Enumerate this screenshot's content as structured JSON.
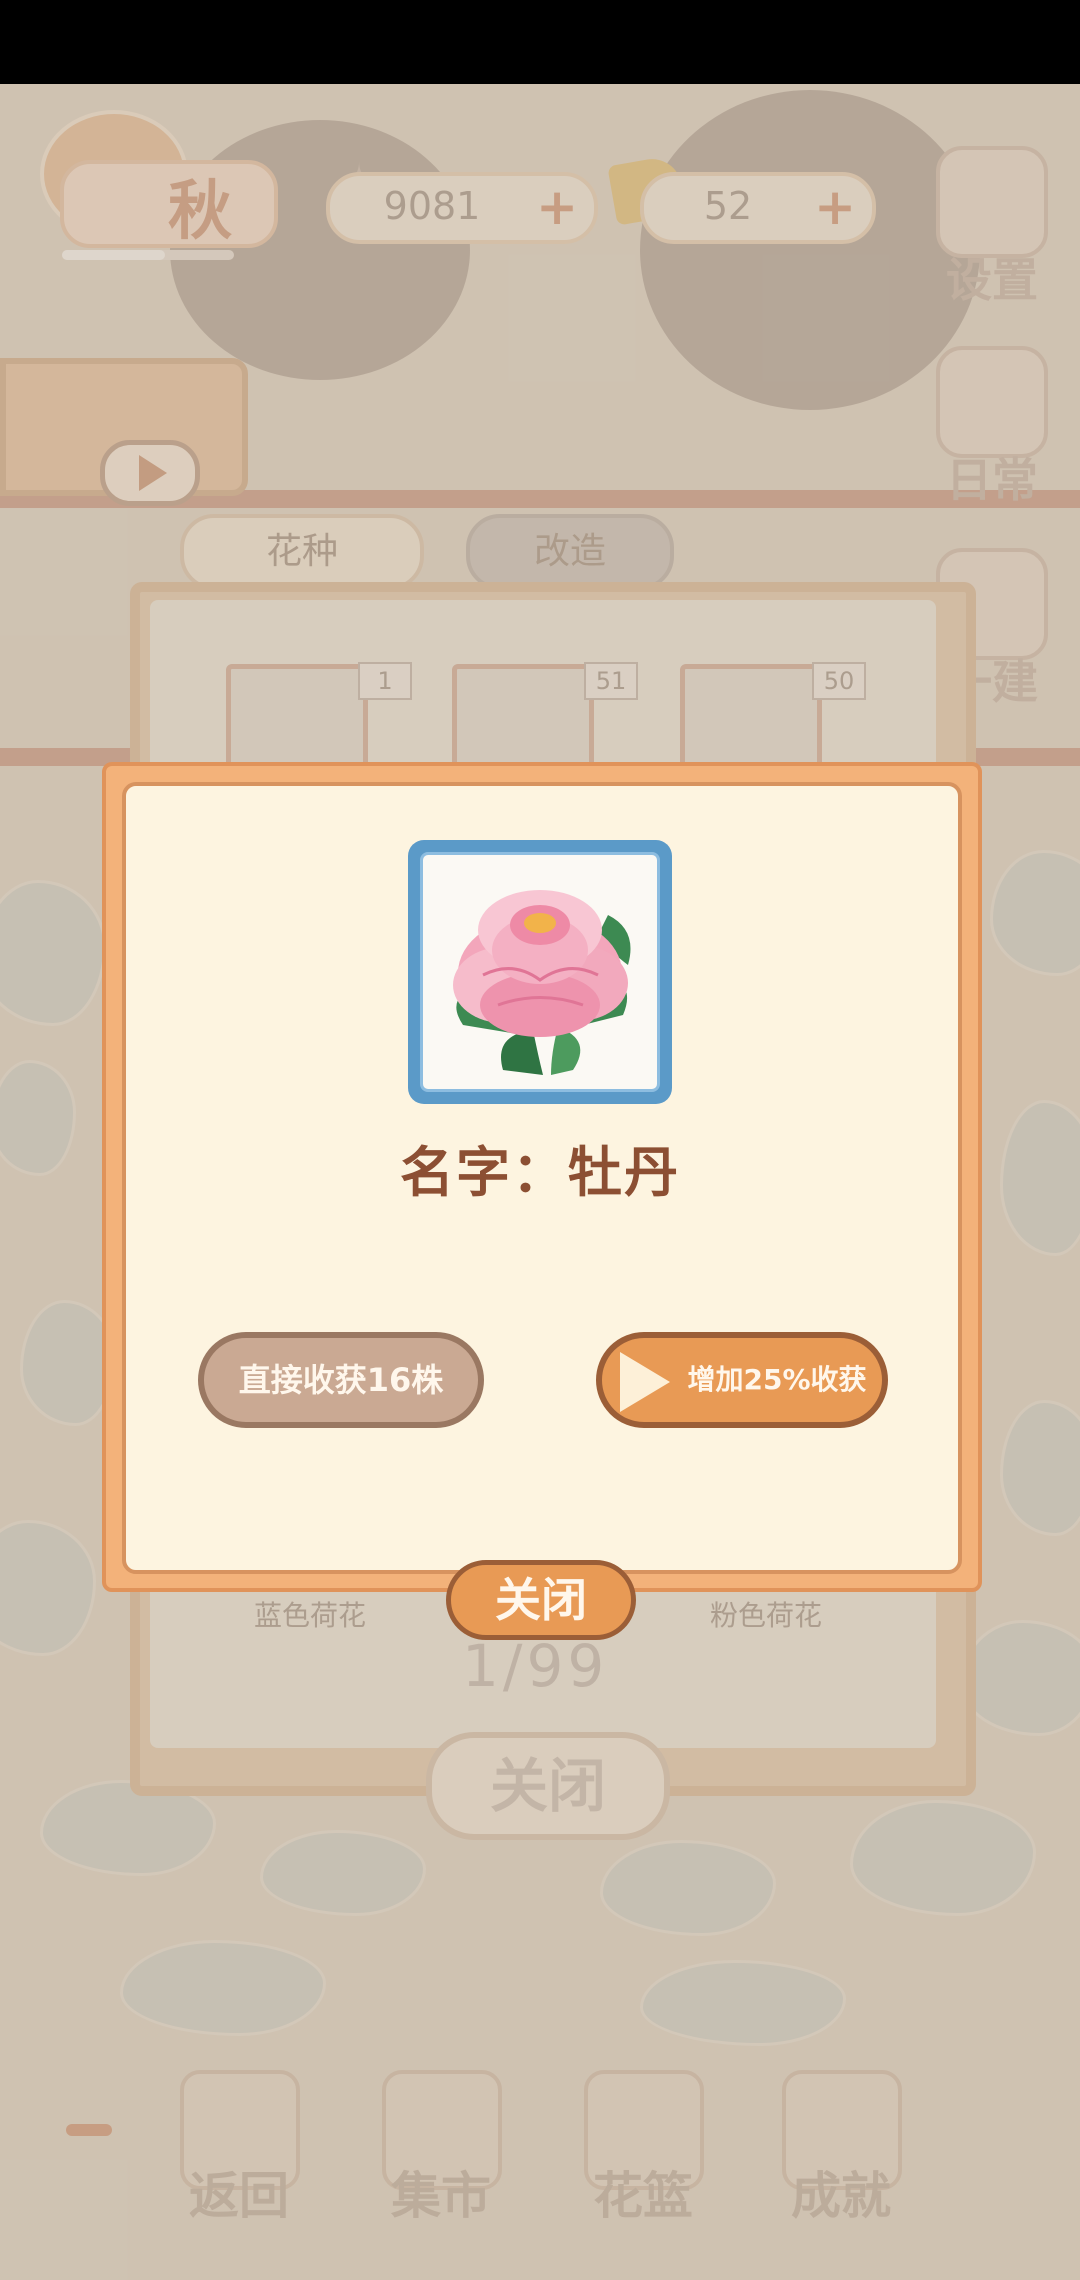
{
  "hud": {
    "season_label": "秋",
    "fish_bones": "9081",
    "cheese": "52",
    "plus_symbol": "+"
  },
  "side_menu": {
    "settings_label": "设置",
    "daily_label": "日常",
    "build_label": "一建"
  },
  "tabs": {
    "seed_label": "花种",
    "modify_label": "改造"
  },
  "seed_counts": [
    "1",
    "51",
    "50"
  ],
  "background_panel": {
    "left_item_label": "蓝色荷花",
    "right_item_label": "粉色荷花",
    "count": "1/99",
    "close_label": "关闭"
  },
  "bottom_nav": {
    "back_label": "返回",
    "market_label": "集市",
    "basket_label": "花篮",
    "achievement_label": "成就"
  },
  "dialog": {
    "flower_name_prefix": "名字：",
    "flower_name": "牡丹",
    "harvest_button": "直接收获16株",
    "boost_button": "增加25%收获",
    "close_button": "关闭"
  },
  "colors": {
    "dialog_orange": "#f3b27a",
    "dialog_cream": "#fdf4e0",
    "button_orange": "#e89a55",
    "button_tan": "#caa993",
    "title_brown": "#8c4f33",
    "frame_blue": "#5b9ac8"
  },
  "icons": [
    "fish-bone-icon",
    "cheese-icon",
    "gear-icon",
    "calendar-icon",
    "hammer-icon",
    "watering-can-icon",
    "play-icon",
    "sprout-icon",
    "wrench-icon",
    "peony-flower-image"
  ]
}
